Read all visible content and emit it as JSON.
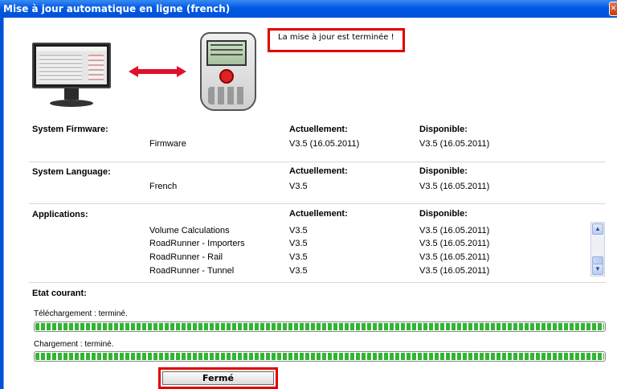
{
  "window": {
    "title": "Mise à jour automatique en ligne (french)",
    "close_glyph": "✕"
  },
  "status_message": "La mise à jour est terminée !",
  "columns": {
    "current": "Actuellement:",
    "available": "Disponible:"
  },
  "firmware": {
    "section": "System Firmware:",
    "items": [
      {
        "name": "Firmware",
        "current": "V3.5 (16.05.2011)",
        "available": "V3.5 (16.05.2011)"
      }
    ]
  },
  "language": {
    "section": "System Language:",
    "items": [
      {
        "name": "French",
        "current": "V3.5",
        "available": "V3.5 (16.05.2011)"
      }
    ]
  },
  "applications": {
    "section": "Applications:",
    "items": [
      {
        "name": "Volume Calculations",
        "current": "V3.5",
        "available": "V3.5 (16.05.2011)"
      },
      {
        "name": "RoadRunner - Importers",
        "current": "V3.5",
        "available": "V3.5 (16.05.2011)"
      },
      {
        "name": "RoadRunner - Rail",
        "current": "V3.5",
        "available": "V3.5 (16.05.2011)"
      },
      {
        "name": "RoadRunner - Tunnel",
        "current": "V3.5",
        "available": "V3.5 (16.05.2011)"
      }
    ]
  },
  "current_state": {
    "label": "Etat courant:",
    "download": {
      "label": "Téléchargement : terminé.",
      "progress": 1.0
    },
    "upload": {
      "label": "Chargement : terminé.",
      "progress": 1.0
    }
  },
  "buttons": {
    "close": "Fermé"
  },
  "icons": {
    "monitor": "monitor-icon",
    "device": "controller-device-icon",
    "sync": "double-arrow-icon"
  },
  "colors": {
    "titlebar": "#0058e6",
    "highlight": "#e00000",
    "progress": "#31b531"
  }
}
